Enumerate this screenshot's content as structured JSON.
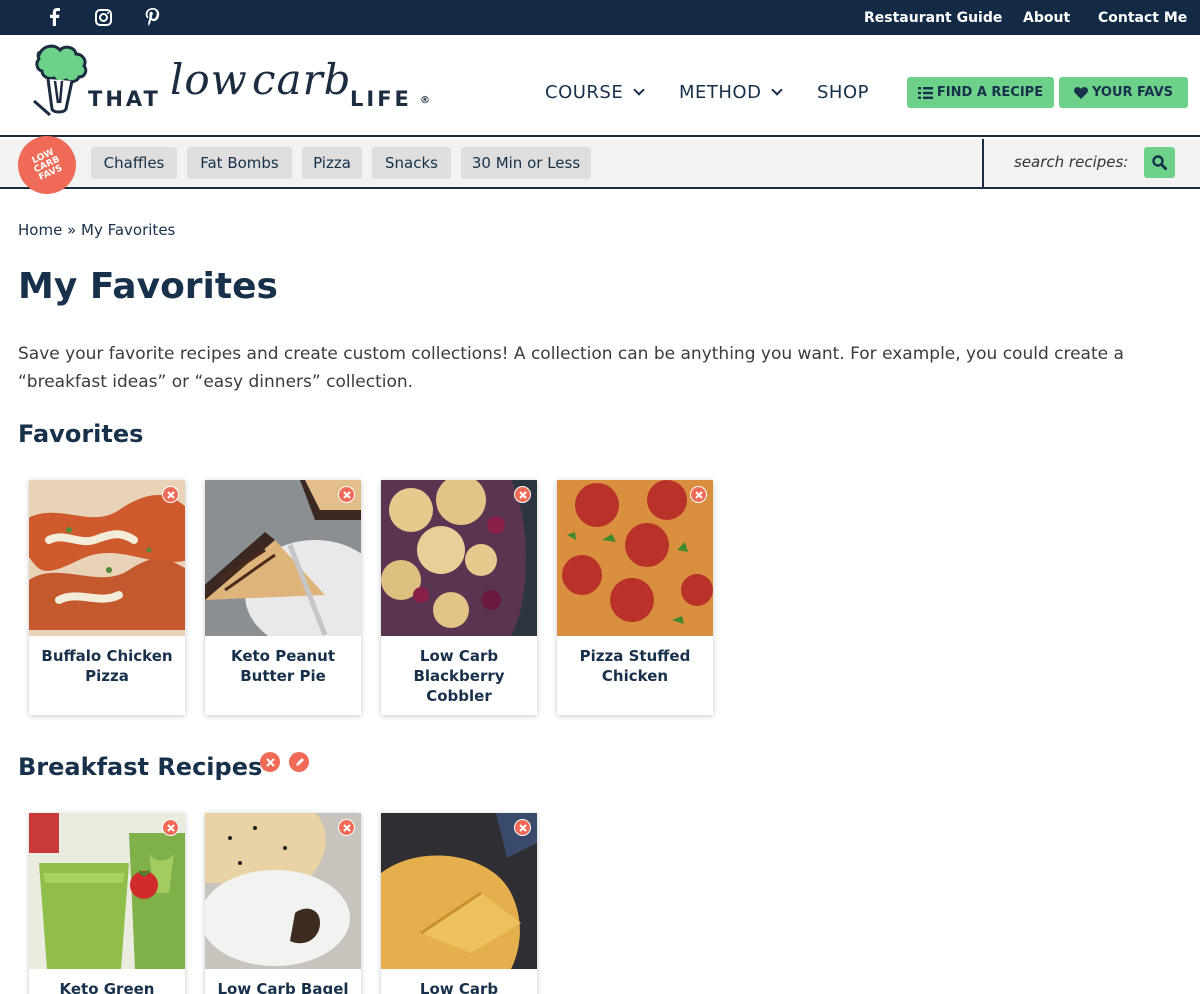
{
  "topbar": {
    "social": [
      "facebook-icon",
      "instagram-icon",
      "pinterest-icon"
    ],
    "links": [
      "Restaurant Guide",
      "About",
      "Contact Me"
    ]
  },
  "logo": {
    "word1": "THAT",
    "word2": "low",
    "word3": "carb",
    "word4": "LIFE",
    "mark": "®"
  },
  "mainnav": {
    "course": "COURSE",
    "method": "METHOD",
    "shop": "SHOP"
  },
  "buttons": {
    "find": "FIND A RECIPE",
    "favs": "YOUR FAVS"
  },
  "quickbar": {
    "badge": [
      "LOW",
      "CARB",
      "FAVS"
    ],
    "pills": [
      "Chaffles",
      "Fat Bombs",
      "Pizza",
      "Snacks",
      "30 Min or Less"
    ],
    "search_label": "search recipes:"
  },
  "breadcrumb": {
    "home": "Home",
    "sep": " » ",
    "current": "My Favorites"
  },
  "page": {
    "title": "My Favorites",
    "intro": "Save your favorite recipes and create custom collections! A collection can be anything you want. For example, you could create a “breakfast ideas” or “easy dinners” collection."
  },
  "sections": {
    "favorites": {
      "title": "Favorites",
      "cards": [
        "Buffalo Chicken Pizza",
        "Keto Peanut Butter Pie",
        "Low Carb Blackberry Cobbler",
        "Pizza Stuffed Chicken"
      ]
    },
    "breakfast": {
      "title": "Breakfast Recipes",
      "cards": [
        "Keto Green",
        "Low Carb Bagel",
        "Low Carb"
      ]
    }
  },
  "colors": {
    "navy": "#132a44",
    "green": "#6dd18a",
    "coral": "#ef6b57"
  }
}
